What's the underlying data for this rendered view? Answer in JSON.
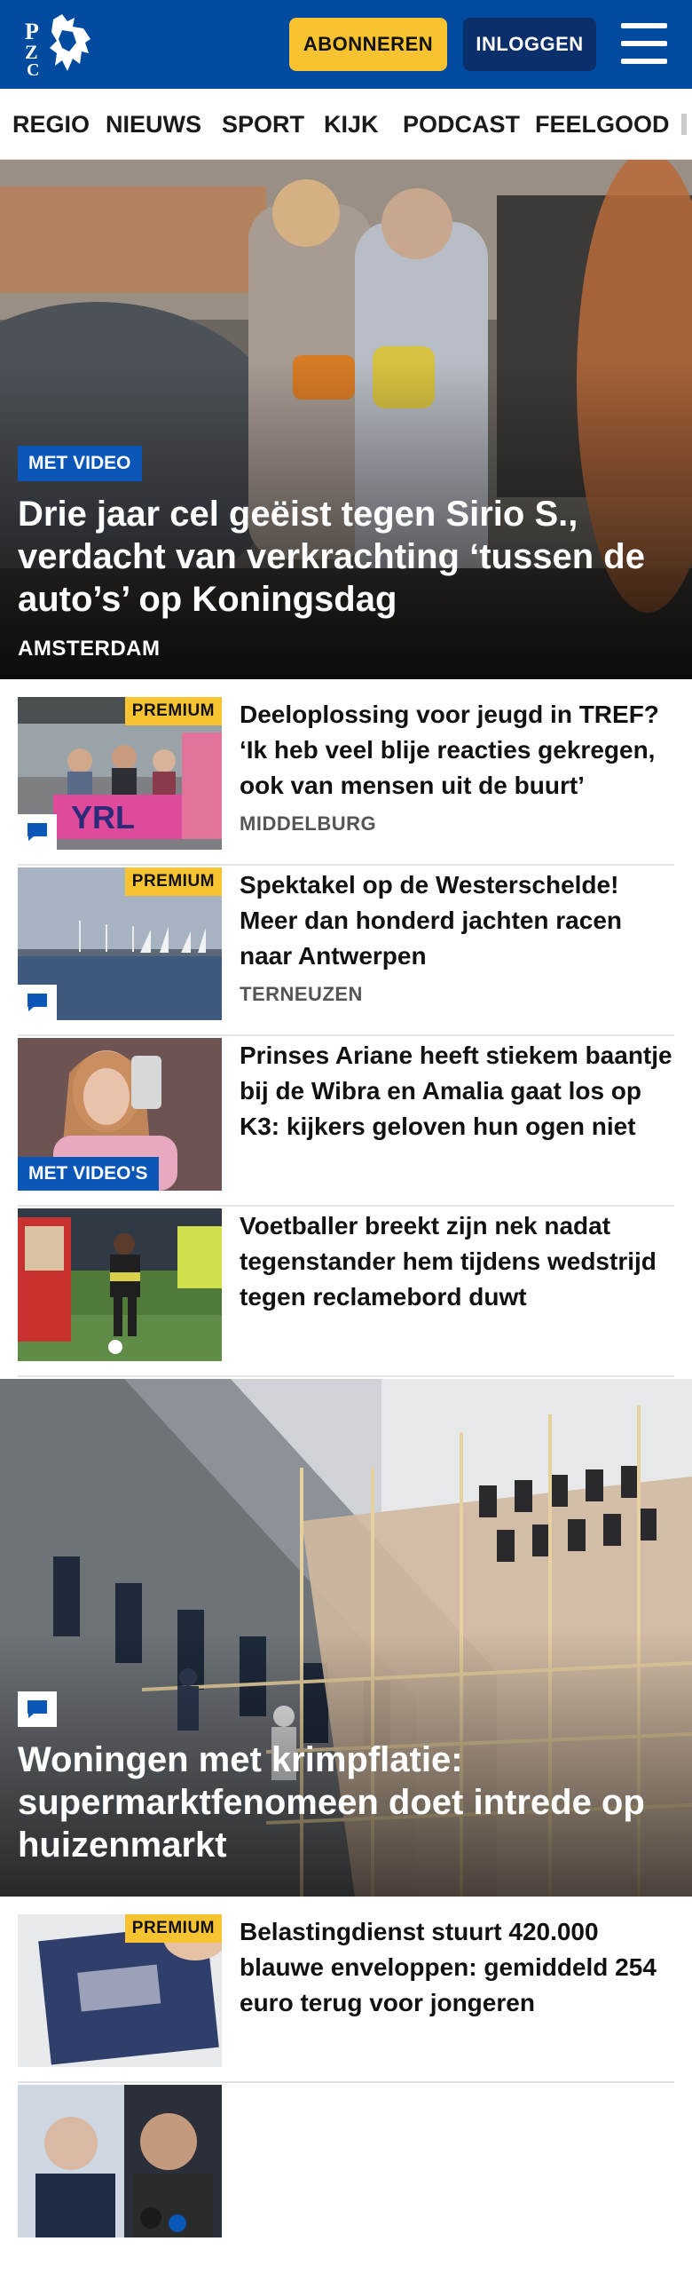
{
  "header": {
    "brand": "PZC",
    "subscribe_label": "ABONNEREN",
    "login_label": "INLOGGEN",
    "colors": {
      "bar": "#004a9f",
      "subscribe": "#f7c330",
      "login": "#0a2f6b"
    }
  },
  "nav": {
    "items": [
      "REGIO",
      "NIEUWS",
      "SPORT",
      "KIJK",
      "PODCAST",
      "FEELGOOD"
    ]
  },
  "hero": {
    "badge": "MET VIDEO",
    "title": "Drie jaar cel geëist tegen Sirio S., verdacht van verkrachting ‘tussen de auto’s’ op Koningsdag",
    "location": "AMSTERDAM"
  },
  "articles": [
    {
      "title": "Deeloplossing voor jeugd in TREF? ‘Ik heb veel blije reacties gekregen, ook van mensen uit de buurt’",
      "location": "MIDDELBURG",
      "premium": "PREMIUM",
      "icon": "comment-icon"
    },
    {
      "title": "Spektakel op de Westerschelde! Meer dan honderd jachten racen naar Antwerpen",
      "location": "TERNEUZEN",
      "premium": "PREMIUM",
      "icon": "comment-icon"
    },
    {
      "title": "Prinses Ariane heeft stiekem baantje bij de Wibra en Amalia gaat los op K3: kijkers geloven hun ogen niet",
      "badge": "MET VIDEO'S"
    },
    {
      "title": "Voetballer breekt zijn nek nadat tegenstander hem tijdens wedstrijd tegen reclamebord duwt"
    }
  ],
  "feature": {
    "title": "Woningen met krimpflatie: supermarktfenomeen doet intrede op huizenmarkt",
    "icon": "comment-icon"
  },
  "articles2": [
    {
      "title": "Belastingdienst stuurt 420.000 blauwe enveloppen: gemiddeld 254 euro terug voor jongeren",
      "premium": "PREMIUM"
    }
  ]
}
